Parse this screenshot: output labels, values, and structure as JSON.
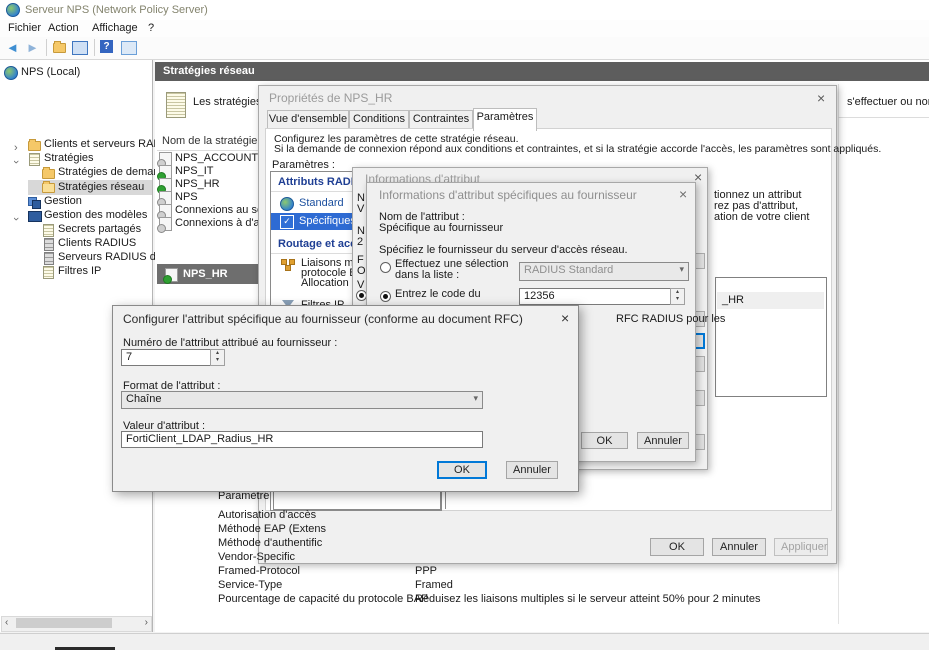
{
  "window": {
    "title": "Serveur NPS (Network Policy Server)"
  },
  "menu": {
    "items": [
      "Fichier",
      "Action",
      "Affichage",
      "?"
    ]
  },
  "tree": {
    "items": [
      {
        "label": "NPS (Local)"
      },
      {
        "label": "Clients et serveurs RADIUS"
      },
      {
        "label": "Stratégies"
      },
      {
        "label": "Stratégies de demande"
      },
      {
        "label": "Stratégies réseau"
      },
      {
        "label": "Gestion"
      },
      {
        "label": "Gestion des modèles"
      },
      {
        "label": "Secrets partagés"
      },
      {
        "label": "Clients RADIUS"
      },
      {
        "label": "Serveurs RADIUS distan"
      },
      {
        "label": "Filtres IP"
      }
    ]
  },
  "main": {
    "header": "Stratégies réseau",
    "intro_left": "Les stratégies ré",
    "intro_right": "s'effectuer ou non.",
    "list_header": "Nom de la stratégie",
    "policies": [
      {
        "name": "NPS_ACCOUNTING"
      },
      {
        "name": "NPS_IT"
      },
      {
        "name": "NPS_HR"
      },
      {
        "name": "NPS"
      },
      {
        "name": "Connexions au serveu"
      },
      {
        "name": "Connexions à d'autres"
      }
    ],
    "selected_policy": "NPS_HR",
    "details": {
      "param_header": "Paramètre",
      "rows": [
        {
          "label": "Autorisation d'accès",
          "value": ""
        },
        {
          "label": "Méthode EAP (Extens",
          "value": ""
        },
        {
          "label": "Méthode d'authentific",
          "value": ""
        },
        {
          "label": "Vendor-Specific",
          "value": ""
        },
        {
          "label": "Framed-Protocol",
          "value": "PPP"
        },
        {
          "label": "Service-Type",
          "value": "Framed"
        },
        {
          "label": "Pourcentage de capacité du protocole BAP",
          "value": "Réduisez les liaisons multiples si le serveur atteint 50% pour 2 minutes"
        }
      ]
    }
  },
  "props_dialog": {
    "title": "Propriétés de NPS_HR",
    "tabs": [
      "Vue d'ensemble",
      "Conditions",
      "Contraintes",
      "Paramètres"
    ],
    "active_tab": "Paramètres",
    "desc1": "Configurez les paramètres de cette stratégie réseau.",
    "desc2": "Si la demande de connexion répond aux conditions et contraintes, et si la stratégie accorde l'accès, les paramètres sont appliqués.",
    "params_label": "Paramètres :",
    "sections": {
      "radius": "Attributs RADIUS",
      "routing": "Routage et accès à dis"
    },
    "items": {
      "standard": "Standard",
      "vendor": "Spécifiques au fourn",
      "bap1": "Liaisons multiples et",
      "bap2": "protocole BAP (Band",
      "bap3": "Allocation Protocol)",
      "filters": "Filtres IP"
    },
    "right_fragments": [
      "tionnez un attribut",
      "rez pas d'attribut,",
      "ation de votre client"
    ],
    "list_row": "_HR",
    "buttons": {
      "ok": "OK",
      "cancel": "Annuler",
      "apply": "Appliquer"
    }
  },
  "attr_back_dialog": {
    "title": "Informations d'attribut",
    "fragments": [
      "N",
      "V",
      "N",
      "2",
      "F",
      "O",
      "V"
    ]
  },
  "vendor_dialog": {
    "title": "Informations d'attribut spécifiques au fournisseur",
    "name_label": "Nom de l'attribut :",
    "name_value": "Spécifique au fournisseur",
    "vendor_label": "Spécifiez le fournisseur du serveur d'accès réseau.",
    "radio_select_line1": "Effectuez une sélection",
    "radio_select_line2": "dans la liste :",
    "vendor_combo": "RADIUS Standard",
    "radio_code": "Entrez le code du",
    "code_value": "12356",
    "rfc_fragment": "RFC RADIUS pour les",
    "buttons": {
      "ok": "OK",
      "cancel": "Annuler"
    }
  },
  "rfc_dialog": {
    "title": "Configurer l'attribut spécifique au fournisseur (conforme au document RFC)",
    "number_label": "Numéro de l'attribut attribué au fournisseur :",
    "number_value": "7",
    "format_label": "Format de l'attribut :",
    "format_value": "Chaîne",
    "value_label": "Valeur d'attribut :",
    "attr_value": "FortiClient_LDAP_Radius_HR",
    "buttons": {
      "ok": "OK",
      "cancel": "Annuler"
    }
  },
  "colors": {
    "header_bar": "#5d5d5d",
    "selection": "#2e6bd3",
    "focus": "#0078d7"
  }
}
